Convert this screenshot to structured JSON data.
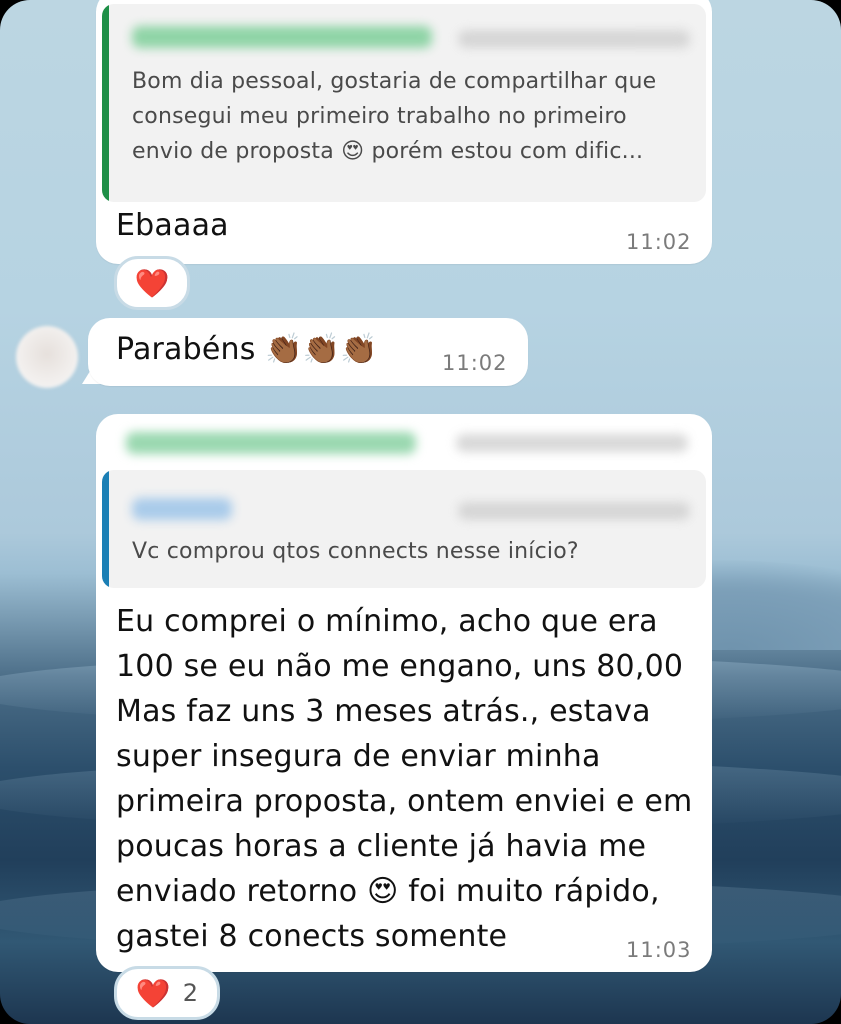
{
  "messages": [
    {
      "reply_quote": {
        "text": "Bom dia pessoal, gostaria de compartilhar que consegui meu primeiro trabalho no primeiro envio de proposta 😍 porém estou com dific...",
        "line1": "Bom dia pessoal, gostaria de compartilhar que",
        "line2": "consegui meu primeiro trabalho no primeiro",
        "line3": "envio de proposta 😍 porém estou com dific..."
      },
      "text": "Ebaaaa",
      "time": "11:02",
      "reaction": {
        "emoji": "❤️",
        "count": ""
      }
    },
    {
      "text": "Parabéns 👏🏾👏🏾👏🏾",
      "time": "11:02"
    },
    {
      "reply_quote": {
        "text": "Vc comprou qtos connects nesse início?"
      },
      "lines": [
        "Eu comprei o mínimo, acho que era",
        "100 se eu não me engano, uns 80,00",
        "Mas faz uns 3 meses atrás., estava",
        "super insegura de enviar minha",
        "primeira proposta, ontem enviei e em",
        "poucas horas a cliente já havia me",
        "enviado retorno 😍  foi muito rápido,",
        "gastei 8 conects somente"
      ],
      "time": "11:03",
      "reaction": {
        "emoji": "❤️",
        "count": "2"
      }
    }
  ],
  "colors": {
    "quote_bar_green": "#1e8f47",
    "quote_bar_blue": "#1b7fb5",
    "sender_green": "#25a85a",
    "sender_blue": "#3d8fd0"
  }
}
